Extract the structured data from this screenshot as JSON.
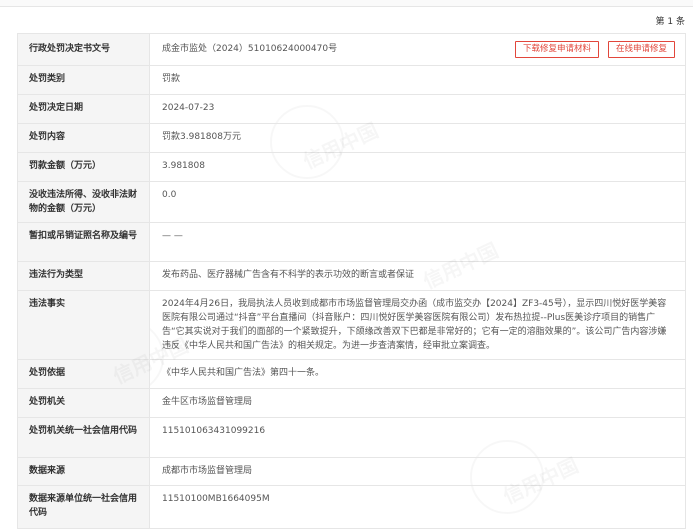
{
  "count": "第 1 条",
  "buttons": {
    "download": "下载修复申请材料",
    "online": "在线申请修复"
  },
  "watermark": "信用中国",
  "rows": [
    {
      "label": "行政处罚决定书文号",
      "value": "成金市监处（2024）51010624000470号"
    },
    {
      "label": "处罚类别",
      "value": "罚款"
    },
    {
      "label": "处罚决定日期",
      "value": "2024-07-23"
    },
    {
      "label": "处罚内容",
      "value": "罚款3.981808万元"
    },
    {
      "label": "罚款金额（万元）",
      "value": "3.981808"
    },
    {
      "label": "没收违法所得、没收非法财物的金额（万元）",
      "value": "0.0"
    },
    {
      "label": "暂扣或吊销证照名称及编号",
      "value": "— —"
    },
    {
      "label": "违法行为类型",
      "value": "发布药品、医疗器械广告含有不科学的表示功效的断言或者保证"
    },
    {
      "label": "违法事实",
      "value": "2024年4月26日，我局执法人员收到成都市市场监督管理局交办函（成市监交办【2024】ZF3-45号），显示四川悦好医学美容医院有限公司通过“抖音”平台直播间（抖音账户：四川悦好医学美容医院有限公司）发布热拉提--Plus医美诊疗项目的销售广告“它其实说对于我们的面部的一个紧致提升，下颌缘改善双下巴都是非常好的；它有一定的溶脂效果的”。该公司广告内容涉嫌违反《中华人民共和国广告法》的相关规定。为进一步查清案情，经审批立案调查。"
    },
    {
      "label": "处罚依据",
      "value": "《中华人民共和国广告法》第四十一条。"
    },
    {
      "label": "处罚机关",
      "value": "金牛区市场监督管理局"
    },
    {
      "label": "处罚机关统一社会信用代码",
      "value": "115101063431099216"
    },
    {
      "label": "数据来源",
      "value": "成都市市场监督管理局"
    },
    {
      "label": "数据来源单位统一社会信用代码",
      "value": "11510100MB1664095M"
    }
  ]
}
